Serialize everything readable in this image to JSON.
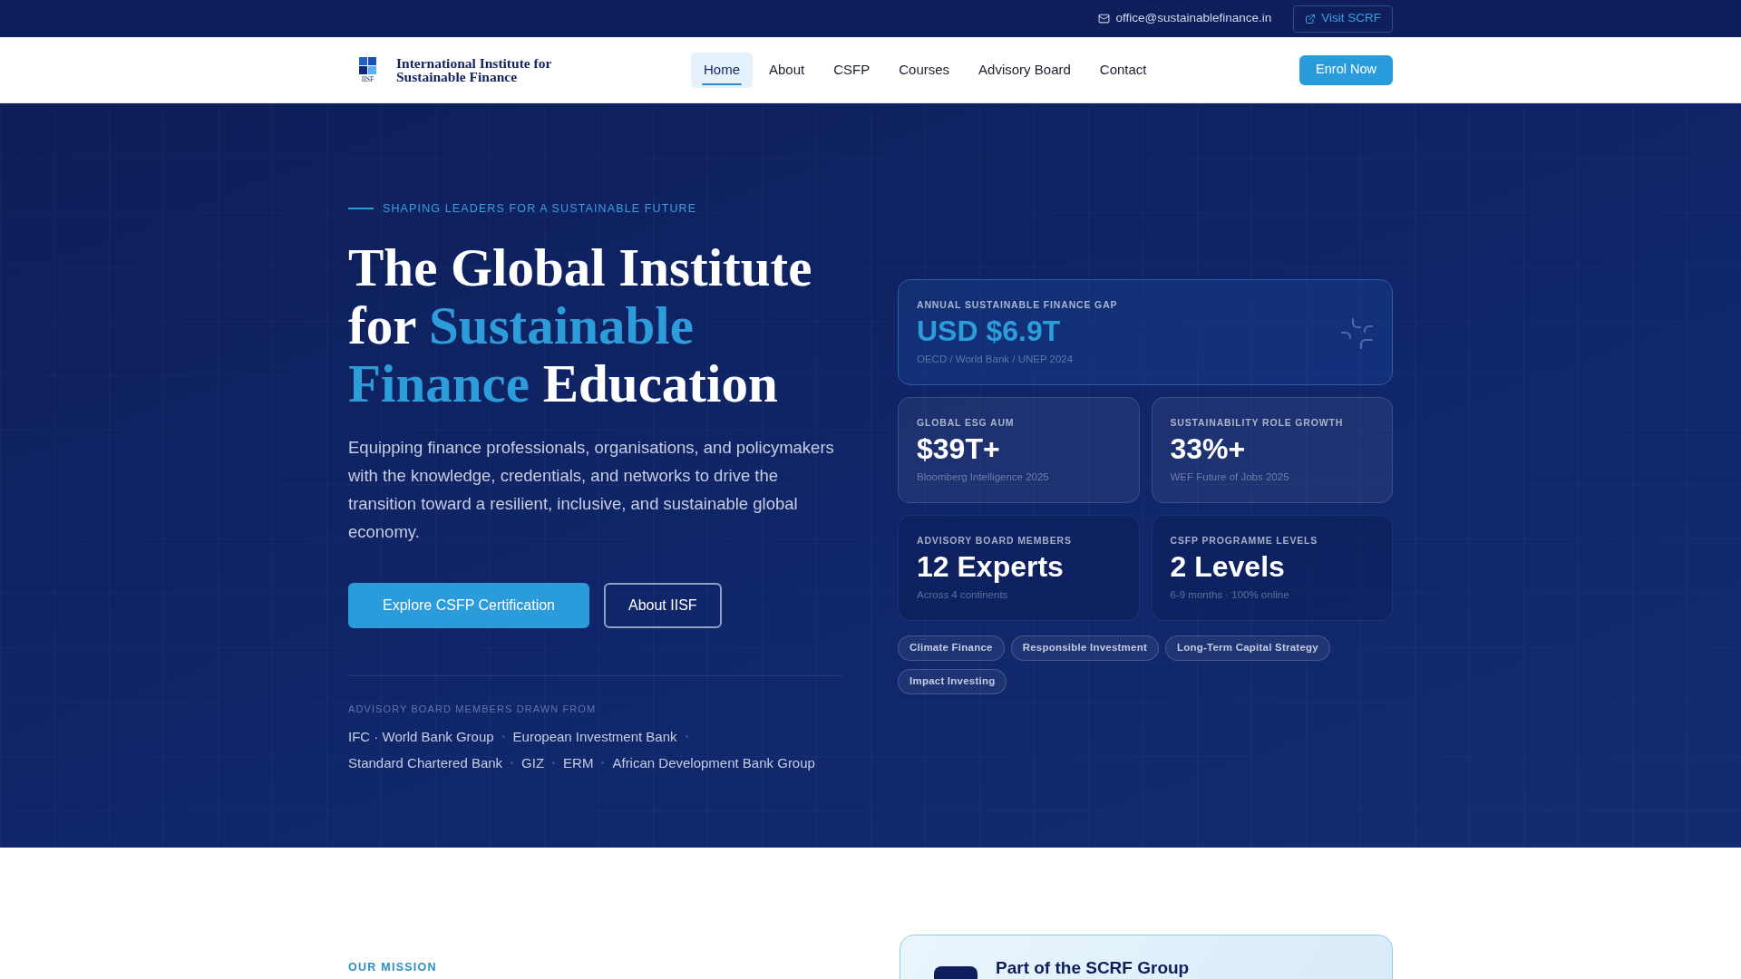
{
  "top_bar": {
    "email": "office@sustainablefinance.in",
    "visit_button": "Visit SCRF"
  },
  "header": {
    "logo": {
      "mark_text": "IISF",
      "name_lines": [
        "International Institute for",
        "Sustainable Finance"
      ]
    },
    "nav": [
      {
        "label": "Home",
        "selected": true
      },
      {
        "label": "About",
        "selected": false
      },
      {
        "label": "CSFP",
        "selected": false
      },
      {
        "label": "Courses",
        "selected": false
      },
      {
        "label": "Advisory Board",
        "selected": false
      },
      {
        "label": "Contact",
        "selected": false
      }
    ],
    "cta": "Enrol Now"
  },
  "hero": {
    "eyebrow": "SHAPING LEADERS FOR A SUSTAINABLE FUTURE",
    "headline": [
      {
        "text": "The Global Institute for ",
        "accent": false
      },
      {
        "text": "Sustainable Finance",
        "accent": true
      },
      {
        "text": " Education",
        "accent": false
      }
    ],
    "description": "Equipping finance professionals, organisations, and policymakers with the knowledge, credentials, and networks to drive the transition toward a resilient, inclusive, and sustainable global economy.",
    "buttons": [
      {
        "label": "Explore CSFP Certification",
        "kind": "primary"
      },
      {
        "label": "About IISF",
        "kind": "outline"
      }
    ],
    "advisory_label": "ADVISORY BOARD MEMBERS DRAWN FROM",
    "organisations": [
      "IFC · World Bank Group",
      "European Investment Bank",
      "Standard Chartered Bank",
      "GIZ",
      "ERM",
      "African Development Bank Group"
    ],
    "stats": [
      {
        "kind": "featured",
        "label": "ANNUAL SUSTAINABLE FINANCE GAP",
        "value": "USD $6.9T",
        "source": "OECD / World Bank / UNEP 2024"
      },
      {
        "kind": "light",
        "label": "GLOBAL ESG AUM",
        "value": "$39T+",
        "source": "Bloomberg Intelligence 2025"
      },
      {
        "kind": "light",
        "label": "SUSTAINABILITY ROLE GROWTH",
        "value": "33%+",
        "source": "WEF Future of Jobs 2025"
      },
      {
        "kind": "dark",
        "label": "ADVISORY BOARD MEMBERS",
        "value": "12 Experts",
        "source": "Across 4 continents"
      },
      {
        "kind": "dark",
        "label": "CSFP PROGRAMME LEVELS",
        "value": "2 Levels",
        "source": "6-9 months · 100% online"
      }
    ],
    "tags": [
      "Climate Finance",
      "Responsible Investment",
      "Long-Term Capital Strategy",
      "Impact Investing"
    ]
  },
  "mission_section": {
    "eyebrow": "OUR MISSION",
    "group_card": {
      "title": "Part of the SCRF Group"
    }
  }
}
